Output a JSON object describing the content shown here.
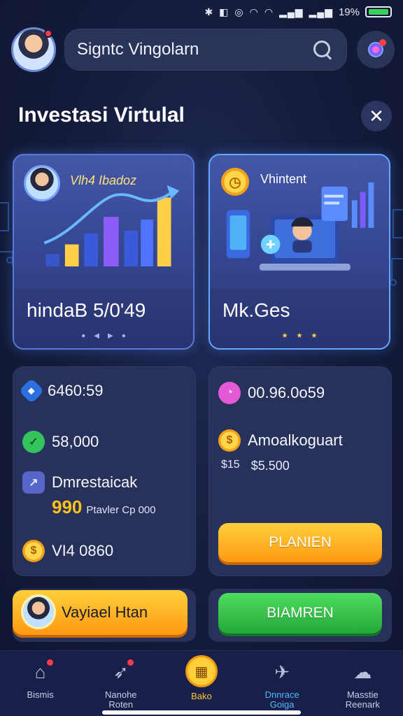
{
  "status_bar": {
    "battery_text": "19%"
  },
  "header": {
    "search_text": "Signtc Vingolarn"
  },
  "page": {
    "title": "Investasi Virtulal"
  },
  "feature_cards": [
    {
      "tag": "Vlh4 Ibadoz",
      "value": "hindaB 5/0'49"
    },
    {
      "tag": "Vhintent",
      "value": "Mk.Ges"
    }
  ],
  "left_panel": {
    "stat_1": "6460:59",
    "stat_2": "58,000",
    "stat_3_label": "Dmrestaicak",
    "stat_3_value": "990",
    "stat_3_sub": "Ptavler Cp 000",
    "stat_4": "VI4 0860"
  },
  "right_panel": {
    "stat_1": "00.96.0o59",
    "stat_2_label": "Amoalkoguart",
    "amount_a": "$15",
    "amount_b": "$5.500",
    "button": "PLANIEN"
  },
  "actions": {
    "invest_button": "Vayiael Htan",
    "green_button": "BIAMREN"
  },
  "nav": [
    {
      "label": "Bismis",
      "icon": "home-icon"
    },
    {
      "label": "Nanohe Roten",
      "icon": "rocket-icon"
    },
    {
      "label": "Bako",
      "icon": "calendar-icon"
    },
    {
      "label": "Dnnrace Goiga",
      "icon": "paper-plane-icon"
    },
    {
      "label": "Masstie Reenark",
      "icon": "chat-icon"
    }
  ],
  "colors": {
    "accent_orange": "#ff9a12",
    "accent_green": "#23a83a",
    "background": "#141b3a",
    "active_nav": "#ffc83a"
  }
}
